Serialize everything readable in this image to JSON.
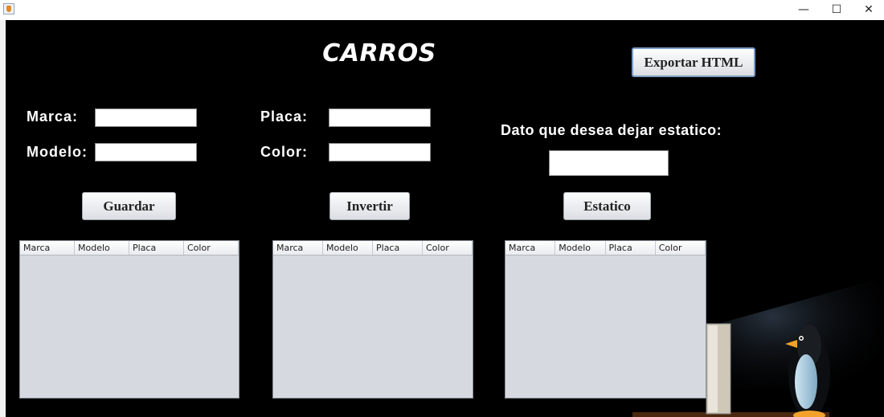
{
  "window": {
    "title": "",
    "minimize": "—",
    "maximize": "☐",
    "close": "✕"
  },
  "main": {
    "title": "CARROS"
  },
  "form": {
    "marca_label": "Marca:",
    "modelo_label": "Modelo:",
    "placa_label": "Placa:",
    "color_label": "Color:",
    "marca_value": "",
    "modelo_value": "",
    "placa_value": "",
    "color_value": "",
    "static_label": "Dato que desea dejar estatico:",
    "static_value": ""
  },
  "buttons": {
    "export": "Exportar HTML",
    "guardar": "Guardar",
    "invertir": "Invertir",
    "estatico": "Estatico"
  },
  "tables": [
    {
      "columns": [
        "Marca",
        "Modelo",
        "Placa",
        "Color"
      ],
      "rows": []
    },
    {
      "columns": [
        "Marca",
        "Modelo",
        "Placa",
        "Color"
      ],
      "rows": []
    },
    {
      "columns": [
        "Marca",
        "Modelo",
        "Placa",
        "Color"
      ],
      "rows": []
    }
  ],
  "colors": {
    "background": "#000000",
    "table_bg": "#d6d9df",
    "field_bg": "#ffffff"
  },
  "icons": {
    "app": "java-icon",
    "mascot": "penguin-illustration"
  }
}
